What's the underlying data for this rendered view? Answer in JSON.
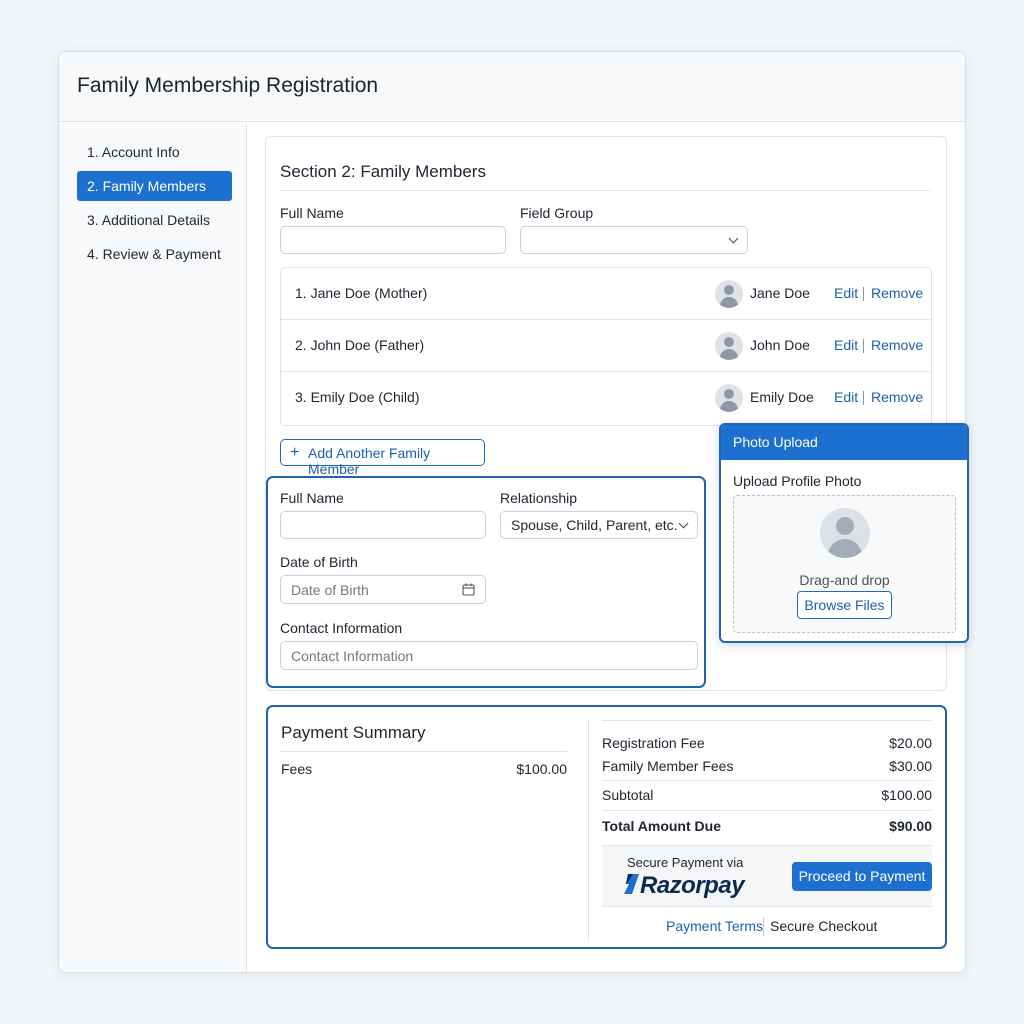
{
  "window": {
    "title": "Family Membership Registration"
  },
  "sidebar": {
    "items": [
      {
        "label": "1. Account Info"
      },
      {
        "label": "2. Family Members"
      },
      {
        "label": "3. Additional Details"
      },
      {
        "label": "4. Review & Payment"
      }
    ],
    "active_index": 1
  },
  "section": {
    "title": "Section 2: Family Members",
    "full_name_label": "Full Name",
    "field_group_label": "Field Group",
    "full_name_value": "",
    "field_group_value": ""
  },
  "members": [
    {
      "label": "1. Jane Doe (Mother)",
      "name": "Jane Doe",
      "edit": "Edit",
      "remove": "Remove"
    },
    {
      "label": "2. John Doe (Father)",
      "name": "John Doe",
      "edit": "Edit",
      "remove": "Remove"
    },
    {
      "label": "3. Emily Doe (Child)",
      "name": "Emily Doe",
      "edit": "Edit",
      "remove": "Remove"
    }
  ],
  "add_member": {
    "label": "Add Another Family Member",
    "icon": "plus-icon"
  },
  "new_member_form": {
    "full_name_label": "Full Name",
    "full_name_value": "",
    "relationship_label": "Relationship",
    "relationship_value": "Spouse, Child, Parent, etc.",
    "dob_label": "Date of Birth",
    "dob_placeholder": "Date of Birth",
    "contact_label": "Contact Information",
    "contact_placeholder": "Contact Information"
  },
  "photo_upload": {
    "header": "Photo Upload",
    "title": "Upload Profile Photo",
    "drop_text": "Drag-and drop",
    "browse_label": "Browse Files"
  },
  "payment": {
    "title": "Payment Summary",
    "fees_label": "Fees",
    "fees_value": "$100.00",
    "registration_fee_label": "Registration Fee",
    "registration_fee_value": "$20.00",
    "member_fees_label": "Family Member Fees",
    "member_fees_value": "$30.00",
    "subtotal_label": "Subtotal",
    "subtotal_value": "$100.00",
    "total_label": "Total Amount Due",
    "total_value": "$90.00",
    "secure_label": "Secure Payment via",
    "provider": "Razorpay",
    "proceed_label": "Proceed to Payment",
    "terms_link": "Payment Terms",
    "secure_checkout": "Secure Checkout"
  },
  "colors": {
    "accent": "#1d6fd0",
    "link": "#1c5fae",
    "border_focus": "#1f62ad"
  }
}
